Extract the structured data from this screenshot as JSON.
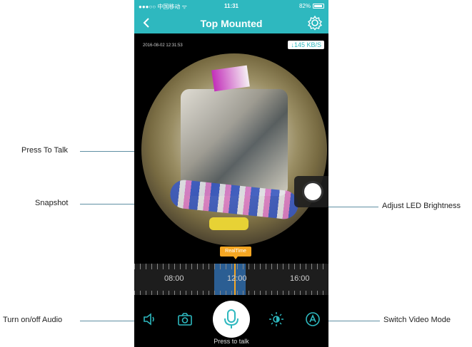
{
  "status_bar": {
    "carrier": "●●●○○ 中国移动 ᯤ",
    "time": "11:31",
    "battery": "82%"
  },
  "nav": {
    "title": "Top Mounted"
  },
  "video": {
    "timestamp": "2016-08-02 12:31:53",
    "speed": "↓145 KB/S"
  },
  "timeline": {
    "realtime_label": "RealTime",
    "labels": [
      "08:00",
      "12:00",
      "16:00"
    ]
  },
  "controls": {
    "talk_label": "Press to talk"
  },
  "callouts": {
    "press_to_talk": "Press To Talk",
    "snapshot": "Snapshot",
    "audio": "Turn on/off Audio",
    "led": "Adjust LED Brightness",
    "video_mode": "Switch Video Mode"
  },
  "colors": {
    "brand": "#2eb8bf",
    "realtime": "#f5a623",
    "recorded": "#2e6aa8"
  },
  "icons": [
    "back-chevron-icon",
    "gear-icon",
    "speaker-icon",
    "camera-icon",
    "microphone-icon",
    "brightness-icon",
    "auto-mode-icon"
  ]
}
